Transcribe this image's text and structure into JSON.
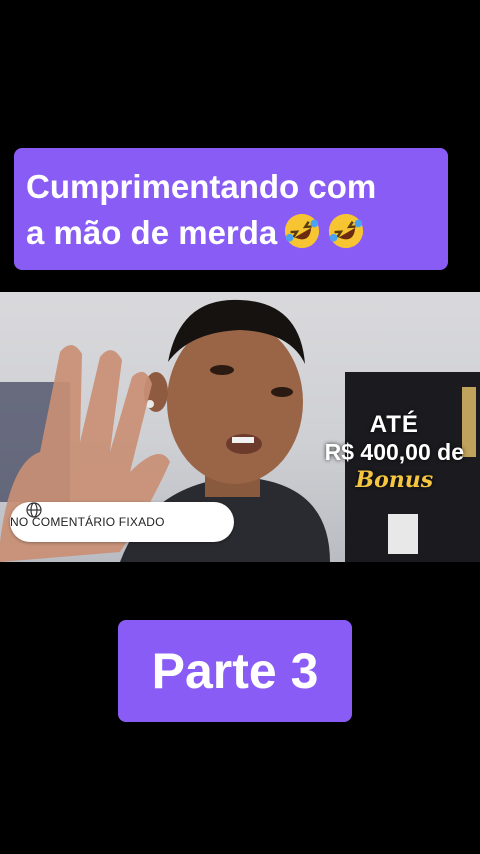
{
  "caption": {
    "line1": "Cumprimentando com",
    "line2": "a mão de merda",
    "emojis": [
      "rolling-on-floor-laughing-icon",
      "rolling-on-floor-laughing-icon"
    ]
  },
  "video": {
    "promo": {
      "top_line": "ATÉ",
      "amount_line": "R$ 400,00 de",
      "script_word": "Bonus"
    },
    "pill": {
      "icon": "globe-icon",
      "label": "NO COMENTÁRIO FIXADO"
    }
  },
  "part": {
    "label": "Parte 3"
  },
  "colors": {
    "accent": "#8a5cf6",
    "background": "#000000"
  }
}
